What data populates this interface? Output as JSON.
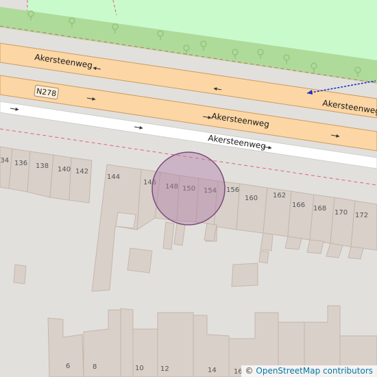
{
  "map": {
    "streets": {
      "main_upper": "Akersteenweg",
      "main_lower": "Akersteenweg",
      "service": "Akersteenweg",
      "south_edge": "Akersteenweg"
    },
    "route_shield": "N278",
    "house_numbers_north": [
      "134",
      "136",
      "138",
      "140",
      "142",
      "144",
      "146",
      "148",
      "150",
      "154",
      "156",
      "160",
      "162",
      "166",
      "168",
      "170",
      "172"
    ],
    "house_numbers_south": [
      "6",
      "8",
      "10",
      "12",
      "14",
      "16"
    ],
    "highlight_circle": {
      "fill": "#b07ea8",
      "stroke": "#7a4a7a",
      "fill_opacity": 0.45
    },
    "colors": {
      "background": "#e2e0dd",
      "trunk_road": "#fcd6a4",
      "trunk_casing": "#c99b62",
      "park": "#c8facc",
      "grass": "#aedb9a",
      "building": "#d9d0c9",
      "building_edge": "#c4b6ab",
      "service_road": "#ffffff",
      "boundary": "#e06070"
    },
    "attribution": {
      "symbol": "©",
      "text": "OpenStreetMap contributors"
    }
  }
}
